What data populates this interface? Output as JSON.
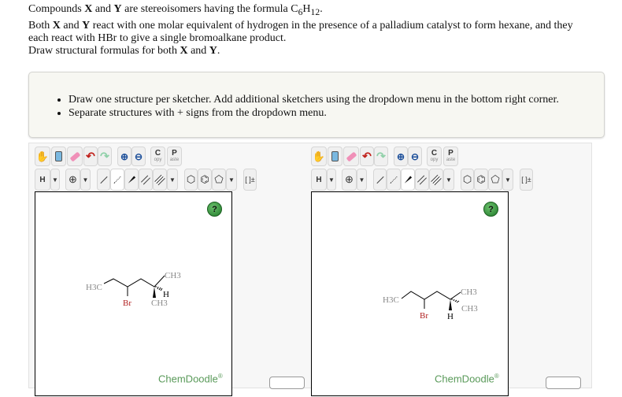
{
  "question": {
    "line1_pre": "Compounds ",
    "x": "X",
    "and": " and ",
    "y": "Y",
    "line1_post": " are stereoisomers having the formula C",
    "sub6": "6",
    "h": "H",
    "sub12": "12",
    "period": ".",
    "line2_pre": "Both ",
    "line2_post": " react with one molar equivalent of hydrogen in the presence of a palladium catalyst to form hexane, and they",
    "line3": "each react with HBr to give a single bromoalkane product.",
    "line4_pre": "Draw structural formulas for both "
  },
  "instructions": [
    "Draw one structure per sketcher. Add additional sketchers using the dropdown menu in the bottom right corner.",
    "Separate structures with + signs from the dropdown menu."
  ],
  "toolbar": {
    "copy_label": "C",
    "copy_sub": "opy",
    "paste_label": "P",
    "paste_sub": "aste",
    "h_label": "H",
    "charge_label": "⊕",
    "bracket_label": "[ ]±"
  },
  "sketcher": {
    "help_label": "?",
    "brand": "ChemDoodle",
    "brand_mark": "®"
  },
  "molecule_x": {
    "h3c": "H3C",
    "br": "Br",
    "ch3_top": "CH3",
    "h": "H",
    "ch3_bottom": "CH3"
  },
  "molecule_y": {
    "h3c": "H3C",
    "br": "Br",
    "ch3_top": "CH3",
    "ch3_hashed": "CH3",
    "h": "H"
  },
  "colors": {
    "bromine": "#b22222",
    "brand": "#5a9a5a"
  }
}
